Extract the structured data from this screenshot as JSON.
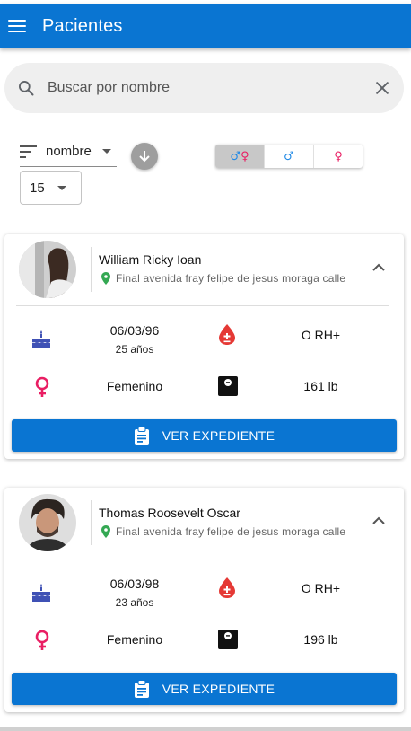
{
  "appbar": {
    "title": "Pacientes",
    "color": "#0a75d2"
  },
  "search": {
    "placeholder": "Buscar por nombre"
  },
  "filters": {
    "sort_by": "nombre",
    "page_size": "15",
    "gender_options": [
      {
        "label": "♂♀",
        "active": true
      },
      {
        "label": "♂",
        "active": false
      },
      {
        "label": "♀",
        "active": false
      }
    ]
  },
  "patients": [
    {
      "name": "William Ricky Ioan",
      "address": "Final avenida fray felipe de jesus moraga calle",
      "birthdate": "06/03/96",
      "age": "25 años",
      "blood_type": "O RH+",
      "sex": "Femenino",
      "weight": "161 lb",
      "button_label": "VER EXPEDIENTE"
    },
    {
      "name": "Thomas Roosevelt Oscar",
      "address": "Final avenida fray felipe de jesus moraga calle",
      "birthdate": "06/03/98",
      "age": "23 años",
      "blood_type": "O RH+",
      "sex": "Femenino",
      "weight": "196 lb",
      "button_label": "VER EXPEDIENTE"
    }
  ]
}
